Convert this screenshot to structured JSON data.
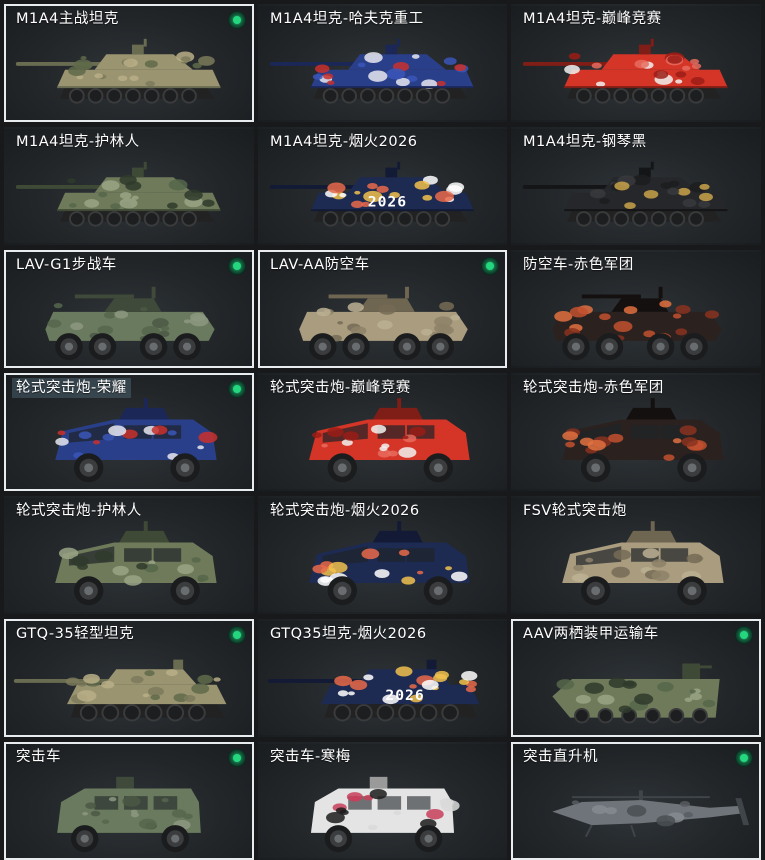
{
  "vehicles": [
    {
      "id": "m1a4",
      "label": "M1A4主战坦克",
      "owned": true,
      "kind": "tank",
      "skin": "camo-tan"
    },
    {
      "id": "m1a4-hafuke",
      "label": "M1A4坦克-哈夫克重工",
      "owned": false,
      "kind": "tank",
      "skin": "blue-white"
    },
    {
      "id": "m1a4-dianfeng",
      "label": "M1A4坦克-巅峰竞赛",
      "owned": false,
      "kind": "tank",
      "skin": "red-white"
    },
    {
      "id": "m1a4-hulinren",
      "label": "M1A4坦克-护林人",
      "owned": false,
      "kind": "tank",
      "skin": "camo-green"
    },
    {
      "id": "m1a4-yanhuo",
      "label": "M1A4坦克-烟火2026",
      "owned": false,
      "kind": "tank",
      "skin": "navy-fireworks",
      "plate": "2026"
    },
    {
      "id": "m1a4-gangqinhei",
      "label": "M1A4坦克-钢琴黑",
      "owned": false,
      "kind": "tank",
      "skin": "black"
    },
    {
      "id": "lav-g1",
      "label": "LAV-G1步战车",
      "owned": true,
      "kind": "apc",
      "skin": "green"
    },
    {
      "id": "lav-aa",
      "label": "LAV-AA防空车",
      "owned": true,
      "kind": "apc",
      "skin": "tan"
    },
    {
      "id": "aa-chise",
      "label": "防空车-赤色军团",
      "owned": false,
      "kind": "apc",
      "skin": "red-black"
    },
    {
      "id": "ifv-rongyao",
      "label": "轮式突击炮-荣耀",
      "owned": true,
      "kind": "mrap",
      "skin": "blue-white",
      "tint": true
    },
    {
      "id": "ifv-dianfeng",
      "label": "轮式突击炮-巅峰竞赛",
      "owned": false,
      "kind": "mrap",
      "skin": "red-white"
    },
    {
      "id": "ifv-chise",
      "label": "轮式突击炮-赤色军团",
      "owned": false,
      "kind": "mrap",
      "skin": "red-black"
    },
    {
      "id": "ifv-hulinren",
      "label": "轮式突击炮-护林人",
      "owned": false,
      "kind": "mrap",
      "skin": "camo-green"
    },
    {
      "id": "ifv-yanhuo",
      "label": "轮式突击炮-烟火2026",
      "owned": false,
      "kind": "mrap",
      "skin": "navy-fireworks"
    },
    {
      "id": "fsv",
      "label": "FSV轮式突击炮",
      "owned": false,
      "kind": "mrap",
      "skin": "tan"
    },
    {
      "id": "gtq-35",
      "label": "GTQ-35轻型坦克",
      "owned": true,
      "kind": "lighttank",
      "skin": "camo-tan"
    },
    {
      "id": "gtq35-yanhuo",
      "label": "GTQ35坦克-烟火2026",
      "owned": false,
      "kind": "lighttank",
      "skin": "navy-fireworks",
      "plate": "2026"
    },
    {
      "id": "aav",
      "label": "AAV两栖装甲运输车",
      "owned": true,
      "kind": "aav",
      "skin": "camo-green"
    },
    {
      "id": "tuji",
      "label": "突击车",
      "owned": true,
      "kind": "truck",
      "skin": "green"
    },
    {
      "id": "tuji-hanmei",
      "label": "突击车-寒梅",
      "owned": false,
      "kind": "truck",
      "skin": "white-pink"
    },
    {
      "id": "heli",
      "label": "突击直升机",
      "owned": true,
      "kind": "heli",
      "skin": "grey"
    }
  ],
  "colors": {
    "owned_border": "#e9ecee",
    "owned_dot": "#24d77f",
    "card_bg": "#25292c",
    "page_bg": "#17191b"
  }
}
